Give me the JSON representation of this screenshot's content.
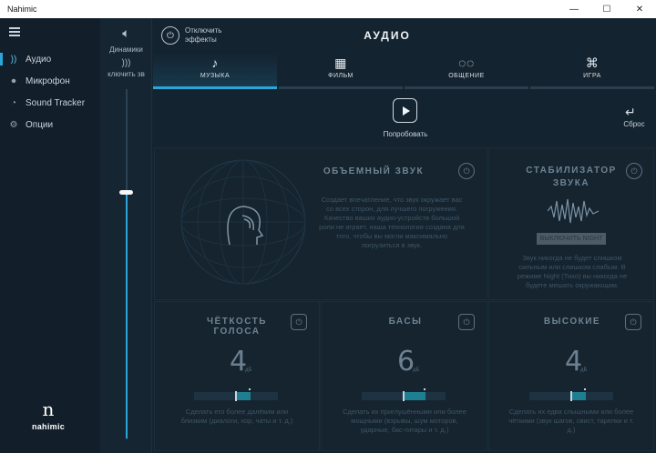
{
  "window": {
    "title": "Nahimic",
    "minimize": "—",
    "maximize": "☐",
    "close": "✕"
  },
  "sidebar": {
    "items": [
      {
        "label": "Аудио",
        "icon": "speaker-waves-icon",
        "glyph": "))"
      },
      {
        "label": "Микрофон",
        "icon": "microphone-icon",
        "glyph": "🎙"
      },
      {
        "label": "Sound Tracker",
        "icon": "tracker-icon",
        "glyph": "◔"
      },
      {
        "label": "Опции",
        "icon": "gear-icon",
        "glyph": "⚙"
      }
    ],
    "logo": {
      "mark": "n",
      "word": "nahimic"
    }
  },
  "volume": {
    "speakers_label": "Динамики",
    "effects_label": "ключить зв",
    "level": 0.7
  },
  "header": {
    "effects_toggle_label": "Отключить эффекты",
    "title": "АУДИО"
  },
  "tabs": [
    {
      "label": "МУЗЫКА",
      "glyph": "♪",
      "active": true
    },
    {
      "label": "ФИЛЬМ",
      "glyph": "🎬",
      "active": false
    },
    {
      "label": "ОБЩЕНИЕ",
      "glyph": "💬",
      "active": false
    },
    {
      "label": "ИГРА",
      "glyph": "🎮",
      "active": false
    }
  ],
  "actions": {
    "try_label": "Попробовать",
    "reset_label": "Сброс"
  },
  "panels": {
    "surround": {
      "title": "ОБЪЕМНЫЙ ЗВУК",
      "desc": "Создает впечатление, что звук окружает вас со всех сторон, для лучшего погружения. Качество ваших аудио-устройств большой роли не играет, наша технология создана для того, чтобы вы могли максимально погрузиться в звук."
    },
    "stabilizer": {
      "title": "СТАБИЛИЗАТОР ЗВУКА",
      "button": "ВЫКЛЮЧИТЬ NIGHT",
      "desc": "Звук никогда не будет слишком сильным или слишком слабым. В режиме Night (Тихо) вы никогда не будете мешать окружающим."
    },
    "voice": {
      "title": "ЧЁТКОСТЬ ГОЛОСА",
      "value": "4",
      "unit": "дБ",
      "level": 0.3,
      "desc": "Сделать его более далёким или близким (диалоги, хор, чаты и т. д.)"
    },
    "bass": {
      "title": "БАСЫ",
      "value": "6",
      "unit": "дБ",
      "level": 0.35,
      "desc": "Сделать их приглушёнными или более мощными (взрывы, шум моторов, ударные, бас-гитары и т. д.)"
    },
    "treble": {
      "title": "ВЫСОКИЕ",
      "value": "4",
      "unit": "дБ",
      "level": 0.3,
      "desc": "Сделать их едва слышными или более чёткими (звук шагов, свист, тарелки и т. д.)"
    }
  }
}
